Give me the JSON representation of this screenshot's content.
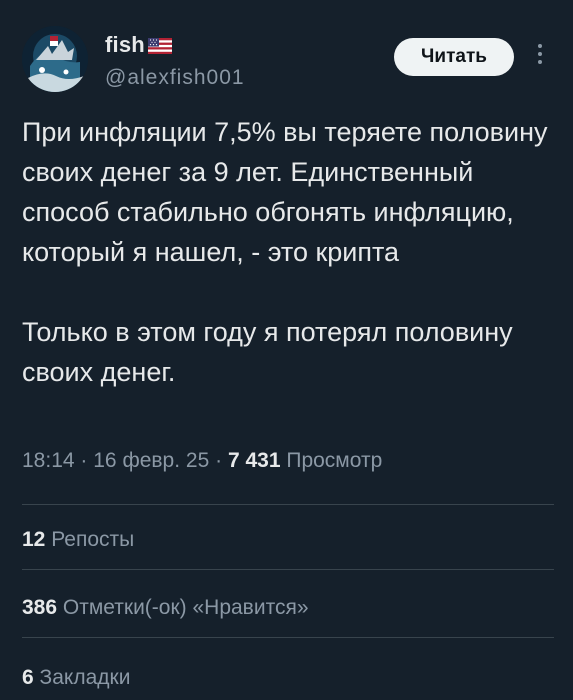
{
  "author": {
    "display_name": "fish",
    "handle": "@alexfish001",
    "flag_icon": "us-flag-icon",
    "avatar_icon": "avatar-image"
  },
  "actions": {
    "follow_label": "Читать",
    "more_icon": "more-vertical-icon"
  },
  "tweet": {
    "paragraph_1": "При инфляции 7,5% вы теряете половину своих денег за 9 лет. Единственный способ стабильно обгонять инфляцию, который я нашел, - это крипта",
    "paragraph_2": "Только в этом году я потерял половину своих денег."
  },
  "meta": {
    "time": "18:14",
    "date": "16 февр. 25",
    "separator": "·",
    "views_count": "7 431",
    "views_label": "Просмотр"
  },
  "stats": {
    "reposts_count": "12",
    "reposts_label": "Репосты",
    "likes_count": "386",
    "likes_label": "Отметки(-ок) «Нравится»",
    "bookmarks_count": "6",
    "bookmarks_label": "Закладки"
  },
  "colors": {
    "background": "#15202b",
    "primary_text": "#e7e9ea",
    "secondary_text": "#8b98a5",
    "divider": "#38444d",
    "button_bg": "#eff3f4"
  }
}
